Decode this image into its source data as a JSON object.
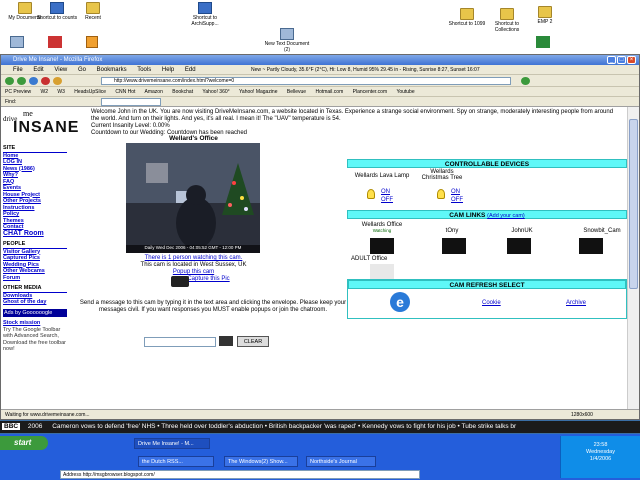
{
  "desktop": {
    "icons": [
      {
        "label": "My Documents"
      },
      {
        "label": "Shortcut to counts"
      },
      {
        "label": "Recent"
      },
      {
        "label": "Shortcut to ArchiSupp..."
      },
      {
        "label": "New Text Document (2)"
      },
      {
        "label": "Shortcut to 1099"
      },
      {
        "label": "Shortcut to Collections"
      },
      {
        "label": "EMP 2"
      }
    ]
  },
  "browser": {
    "title": "Drive Me Insane! - Mozilla Firefox",
    "menu": [
      "File",
      "Edit",
      "View",
      "Go",
      "Bookmarks",
      "Tools",
      "Help",
      "Edd"
    ],
    "weather": "New ~ Partly Cloudy, 35.6°F (2°C), Hi: Low 8, Humid 95% 29.45 in - Rising, Sunrise 8:27, Sunset 16:07",
    "url": "http://www.drivemeinsane.com/index.html?welcome=0",
    "bookmarks": [
      "PC Preview",
      "W2",
      "W3",
      "HeadsUpSlice",
      "CNN Hot",
      "Amazon",
      "Bookchat",
      "Yahoo! 360°",
      "Yahoo! Magazine",
      "Bellevue",
      "Hotmail.com",
      "Plancenter.com",
      "Youtube"
    ],
    "find_label": "Find:",
    "status": "Waiting for www.drivemeinsane.com...",
    "status_right": "1280x600"
  },
  "page": {
    "logo_drive": "drive",
    "logo_me": "me",
    "logo_insane": "INSANE",
    "welcome": "Welcome John in the UK. You are now visiting DriveMeInsane.com, a website located in Texas. Experience a strange social environment. Spy on strange, moderately interesting people from around the world. And turn on their lights. And yes, it's all real. I mean it! The \"UAV\" temperature is 54.",
    "current_insanity": "Current Insanity Level: 0.00%",
    "countdown": "Countdown to our Wedding: Countdown has been reached",
    "sidebar": {
      "site_header": "SITE",
      "site_links": [
        "Home",
        "LOG IN",
        "News (1986)",
        "Why?",
        "FAQ",
        "Events",
        "House Project",
        "Other Projects",
        "Instructions",
        "Policy",
        "Themes",
        "Contact",
        "CHAT Room"
      ],
      "people_header": "PEOPLE",
      "people_links": [
        "Visitor Gallery",
        "Captured Pics",
        "Wedding Pics",
        "Other Webcams",
        "Forum"
      ],
      "media_header": "OTHER MEDIA",
      "media_links": [
        "Downloads",
        "Ghost of the day"
      ],
      "ads_label": "Ads by Goooooogle",
      "stock_label": "Stock mission",
      "stock_text": "Try The Google Toolbar with Advanced Search, Download the free toolbar now!"
    },
    "office_title": "Wellard's Office",
    "cam_caption": "Daily Wed Dec 2006 - 04:05:52 GMT - 12:00 PM",
    "watch_text": "There is 1 person watching this cam.",
    "location_text": "This cam is located in West Sussex, UK",
    "popup_link": "Popup this cam",
    "capture_link": "Capture this Pic",
    "message_text": "Send a message to this cam by typing it in the text area and clicking the envelope. Please keep your messages civil. If you want responses you MUST enable popups or join the chatroom.",
    "clear_label": "CLEAR"
  },
  "devices": {
    "header": "CONTROLLABLE DEVICES",
    "items": [
      {
        "name": "Wellards Lava Lamp",
        "on": "ON",
        "off": "OFF"
      },
      {
        "name": "Wellards Christmas Tree",
        "on": "ON",
        "off": "OFF"
      }
    ]
  },
  "camlinks": {
    "header": "CAM LINKS",
    "add_link": "(Add your cam)",
    "cams": [
      {
        "name": "Wellards Office",
        "sub": "Watching"
      },
      {
        "name": "tOny",
        "sub": ""
      },
      {
        "name": "JohnUK",
        "sub": ""
      },
      {
        "name": "Snowbit_Cam",
        "sub": ""
      }
    ],
    "adult": "ADULT Office"
  },
  "refresh": {
    "header": "CAM REFRESH SELECT",
    "options": [
      "Cookie",
      "Archive"
    ]
  },
  "ticker": {
    "logo": "BBC",
    "year": "2006",
    "items": [
      "Cameron vows to defend 'free' NHS",
      "Three held over toddler's abduction",
      "British backpacker 'was raped'",
      "Kennedy vows to fight for his job",
      "Tube strike talks br"
    ]
  },
  "taskbar": {
    "start": "start",
    "tasks": [
      "Drive Me Insane! - M...",
      "the Dutch RSS...",
      "The Windows(2) Show...",
      "Northside's Journal"
    ],
    "clock": "23:58",
    "day": "Wednesday",
    "date": "1/4/2006",
    "address": "http://msgbrowser.blogspot.com/",
    "addr_label": "Address"
  },
  "colors": {
    "cyan_header": "#5ff8f8",
    "link": "#0000cc",
    "taskbar": "#245edb"
  }
}
